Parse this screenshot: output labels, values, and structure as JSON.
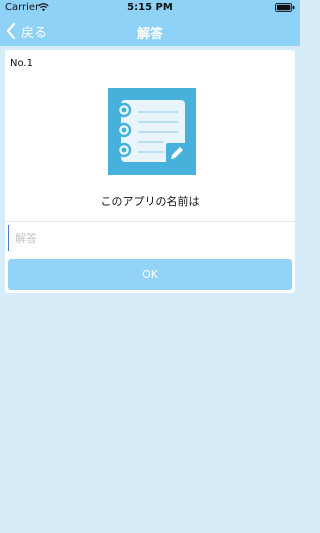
{
  "status_bar": {
    "carrier": "Carrier",
    "time": "5:15 PM"
  },
  "nav": {
    "back_label": "戻る",
    "title": "解答"
  },
  "card": {
    "question_number": "No.1",
    "question_text": "このアプリの名前は",
    "answer_placeholder": "解答",
    "ok_label": "OK"
  },
  "colors": {
    "bar_bg": "#8fd2f7",
    "page_bg": "#d7ecf9",
    "icon_bg": "#47b1dc",
    "button_bg": "#93d3f7"
  },
  "icons": {
    "wifi": "wifi-icon",
    "battery": "battery-icon",
    "back": "chevron-left-icon",
    "app": "notebook-pencil-icon"
  }
}
